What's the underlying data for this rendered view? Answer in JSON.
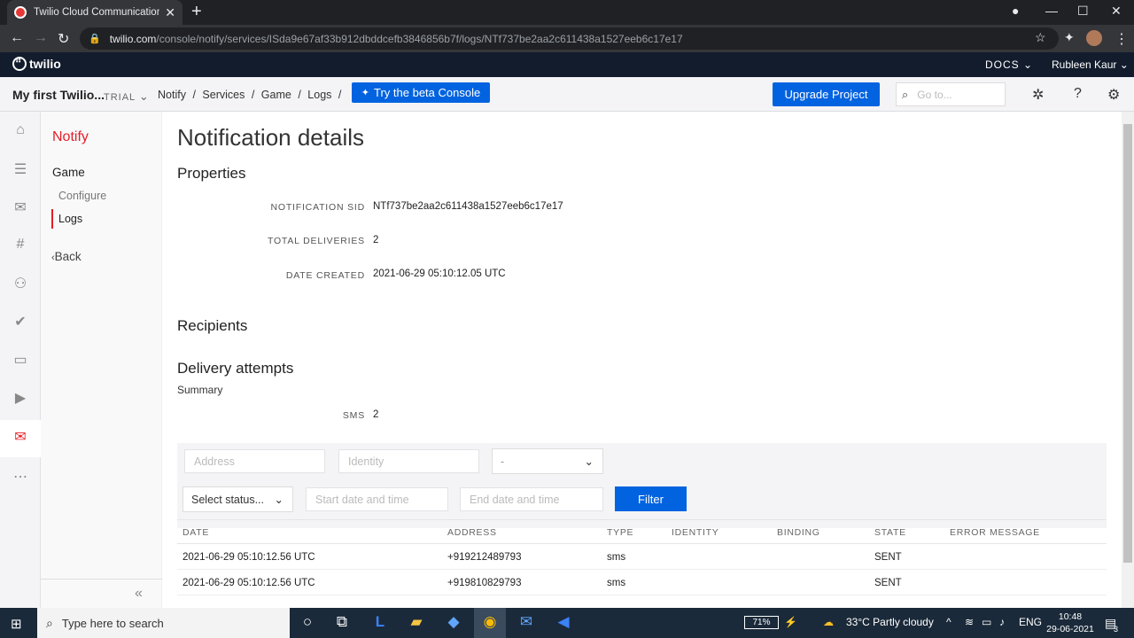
{
  "browser": {
    "tab_title": "Twilio Cloud Communications | W",
    "url_host": "twilio.com",
    "url_path": "/console/notify/services/ISda9e67af33b912dbddcefb3846856b7f/logs/NTf737be2aa2c611438a1527eeb6c17e17"
  },
  "topbar": {
    "logo_text": "twilio",
    "docs_label": "DOCS",
    "user_name": "Rubleen Kaur"
  },
  "crumbbar": {
    "project_name": "My first Twilio...",
    "trial_label": "TRIAL",
    "crumbs": [
      "Notify",
      "/",
      "Services",
      "/",
      "Game",
      "/",
      "Logs",
      "/"
    ],
    "beta_label": "Try the beta Console",
    "upgrade_label": "Upgrade Project",
    "goto_placeholder": "Go to..."
  },
  "subnav": {
    "product": "Notify",
    "group": "Game",
    "items": [
      "Configure",
      "Logs"
    ],
    "back_label": "Back"
  },
  "main": {
    "title": "Notification details",
    "properties_title": "Properties",
    "properties": [
      {
        "label": "NOTIFICATION SID",
        "value": "NTf737be2aa2c611438a1527eeb6c17e17"
      },
      {
        "label": "TOTAL DELIVERIES",
        "value": "2"
      },
      {
        "label": "DATE CREATED",
        "value": "2021-06-29 05:10:12.05 UTC"
      }
    ],
    "recipients_title": "Recipients",
    "delivery_title": "Delivery attempts",
    "summary_label": "Summary",
    "sms_label": "SMS",
    "sms_value": "2"
  },
  "filters": {
    "address_placeholder": "Address",
    "identity_placeholder": "Identity",
    "type_value": "-",
    "status_value": "Select status...",
    "start_placeholder": "Start date and time",
    "end_placeholder": "End date and time",
    "filter_label": "Filter"
  },
  "table": {
    "headers": [
      "DATE",
      "ADDRESS",
      "TYPE",
      "IDENTITY",
      "BINDING",
      "STATE",
      "ERROR MESSAGE"
    ],
    "rows": [
      {
        "date": "2021-06-29 05:10:12.56 UTC",
        "address": "+919212489793",
        "type": "sms",
        "state": "SENT"
      },
      {
        "date": "2021-06-29 05:10:12.56 UTC",
        "address": "+919810829793",
        "type": "sms",
        "state": "SENT"
      }
    ]
  },
  "taskbar": {
    "search_placeholder": "Type here to search",
    "battery": "71%",
    "weather": "33°C  Partly cloudy",
    "lang": "ENG",
    "time": "10:48",
    "date": "29-06-2021",
    "notif_count": "3"
  },
  "colors": {
    "accent": "#0263e0",
    "brand_red": "#e31e26",
    "topbar": "#121c2d"
  }
}
